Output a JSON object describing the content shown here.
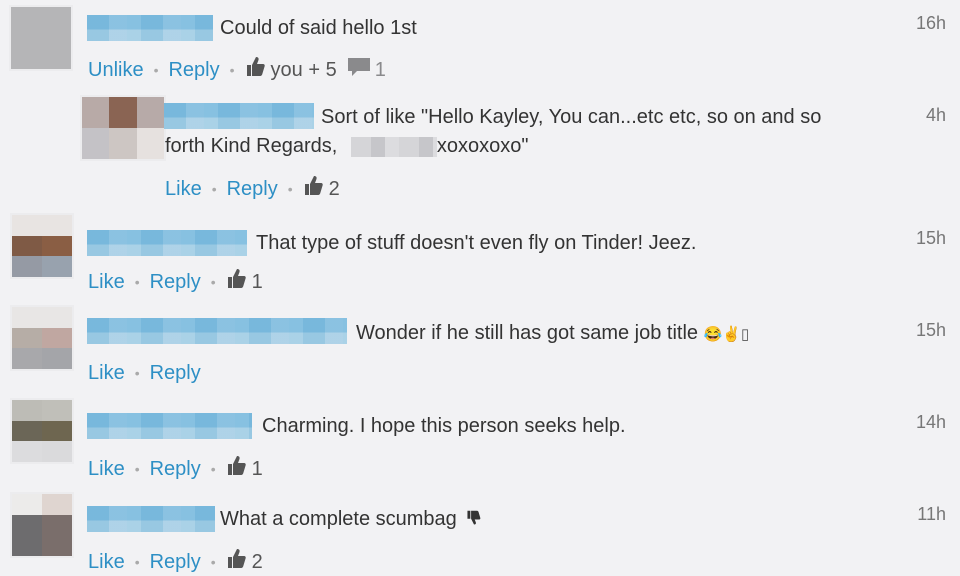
{
  "colors": {
    "link": "#2d8fc5",
    "text": "#333333",
    "timestamp": "#777777",
    "background": "#f2f2f4"
  },
  "comments": [
    {
      "text": "Could of said hello 1st",
      "time": "16h",
      "actions": {
        "like_label": "Unlike",
        "reply_label": "Reply",
        "like_icon": "thumbs-up-icon",
        "likes": "you + 5",
        "reply_icon": "speech-bubble-icon",
        "replies": "1"
      }
    },
    {
      "reply": true,
      "text_line1": "Sort of like  \"Hello Kayley,  You can...etc etc, so on and so",
      "text_line2a": "forth  Kind Regards,",
      "text_line2b": "xoxoxoxo\"",
      "time": "4h",
      "actions": {
        "like_label": "Like",
        "reply_label": "Reply",
        "like_icon": "thumbs-up-icon",
        "likes": "2"
      }
    },
    {
      "text": "That type of stuff doesn't even fly on Tinder! Jeez.",
      "time": "15h",
      "actions": {
        "like_label": "Like",
        "reply_label": "Reply",
        "like_icon": "thumbs-up-icon",
        "likes": "1"
      }
    },
    {
      "text": "Wonder if he still has got same job title",
      "emoji": "😂✌▯",
      "time": "15h",
      "actions": {
        "like_label": "Like",
        "reply_label": "Reply"
      }
    },
    {
      "text": "Charming. I hope this person seeks help.",
      "time": "14h",
      "actions": {
        "like_label": "Like",
        "reply_label": "Reply",
        "like_icon": "thumbs-up-icon",
        "likes": "1"
      }
    },
    {
      "text": "What a complete scumbag",
      "trailing_icon": "thumbs-down-icon",
      "time": "11h",
      "actions": {
        "like_label": "Like",
        "reply_label": "Reply",
        "like_icon": "thumbs-up-icon",
        "likes": "2"
      }
    }
  ],
  "separator": "•"
}
